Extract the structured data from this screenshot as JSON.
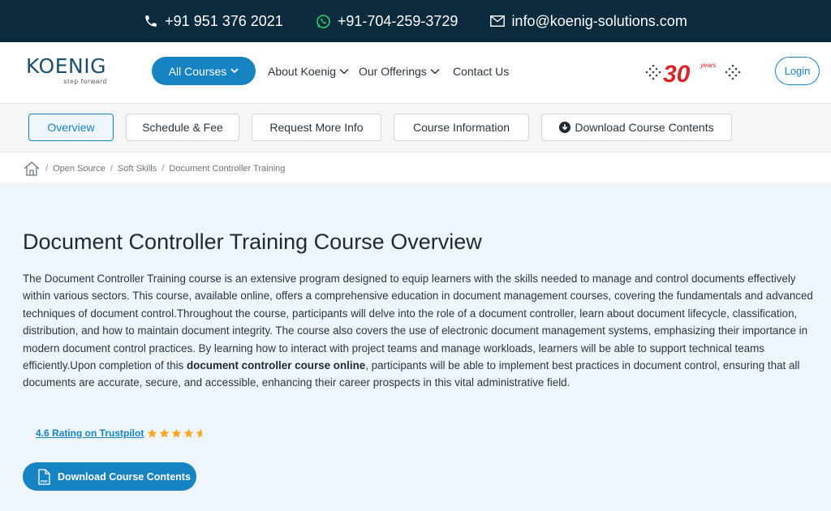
{
  "topbar": {
    "phone": "+91 951 376 2021",
    "whatsapp": "+91-704-259-3729",
    "email": "info@koenig-solutions.com"
  },
  "header": {
    "logo_text": "KOENIG",
    "logo_tagline": "step forward",
    "all_courses": "All Courses",
    "nav": [
      "About Koenig",
      "Our Offerings",
      "Contact Us"
    ],
    "badge_text": "30",
    "badge_years": "years",
    "login": "Login"
  },
  "tabs": [
    "Overview",
    "Schedule & Fee",
    "Request More Info",
    "Course Information",
    "Download Course Contents"
  ],
  "breadcrumb": [
    "Open Source",
    "Soft Skills",
    "Document Controller Training"
  ],
  "main": {
    "title": "Document Controller Training Course Overview",
    "description_before": "The Document Controller Training course is an extensive program designed to equip learners with the skills needed to manage and control documents effectively within various sectors. This course, available online, offers a comprehensive education in document management courses, covering the fundamentals and advanced techniques of document control.Throughout the course, participants will delve into the role of a document controller, learn about document lifecycle, classification, distribution, and how to maintain document integrity. The course also covers the use of electronic document management systems, emphasizing their importance in modern document control practices. By learning how to interact with project teams and manage workloads, learners will be able to support technical teams efficiently.Upon completion of this ",
    "description_bold": "document controller course online",
    "description_after": ", participants will be able to implement best practices in document control, ensuring that all documents are accurate, secure, and accessible, enhancing their career prospects in this vital administrative field.",
    "rating_text": "4.6 Rating on Trustpilot",
    "rating_value": 4.6,
    "download_button": "Download Course Contents"
  },
  "colors": {
    "topbar_bg": "#0c2b3e",
    "accent": "#1684c3",
    "badge_red": "#d9262b",
    "star": "#f5a623",
    "content_bg": "#eef5fb"
  }
}
